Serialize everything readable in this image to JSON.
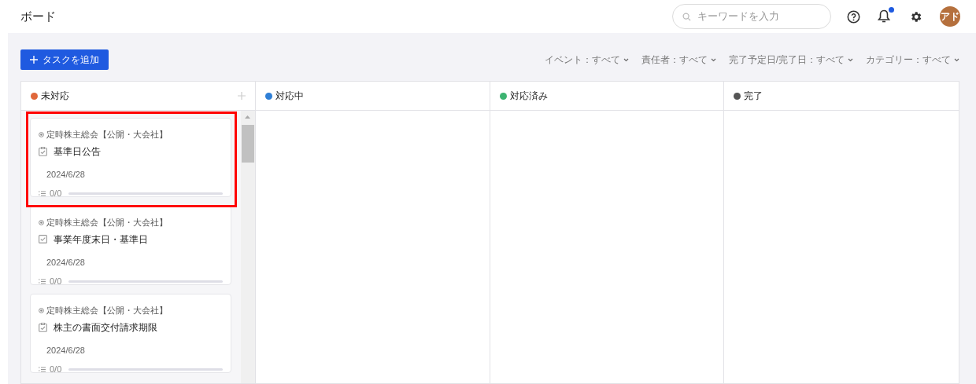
{
  "header": {
    "title": "ボード",
    "search": {
      "placeholder": "キーワードを入力"
    },
    "notification_badge": true,
    "avatar": "アド"
  },
  "toolbar": {
    "add_button": "タスクを追加",
    "filters": [
      "イベント：すべて",
      "責任者：すべて",
      "完了予定日/完了日：すべて",
      "カテゴリー：すべて"
    ]
  },
  "columns": [
    {
      "title": "未対応",
      "color": "#e0673a",
      "add": true,
      "cards": [
        {
          "event": "定時株主総会【公開・大会社】",
          "kind": "clipboard",
          "title": "基準日公告",
          "date": "2024/6/28",
          "progress": "0/0",
          "level": 0
        },
        {
          "event": "定時株主総会【公開・大会社】",
          "kind": "checkbox",
          "title": "事業年度末日・基準日",
          "date": "2024/6/28",
          "progress": "0/0",
          "level": 0
        },
        {
          "event": "定時株主総会【公開・大会社】",
          "kind": "clipboard",
          "title": "株主の書面交付請求期限",
          "date": "2024/6/28",
          "progress": "0/0",
          "level": 0
        }
      ]
    },
    {
      "title": "対応中",
      "color": "#2f7fd6",
      "add": false
    },
    {
      "title": "対応済み",
      "color": "#3cb371",
      "add": false
    },
    {
      "title": "完了",
      "color": "#555555",
      "add": false
    }
  ],
  "highlight": {
    "on": true
  }
}
